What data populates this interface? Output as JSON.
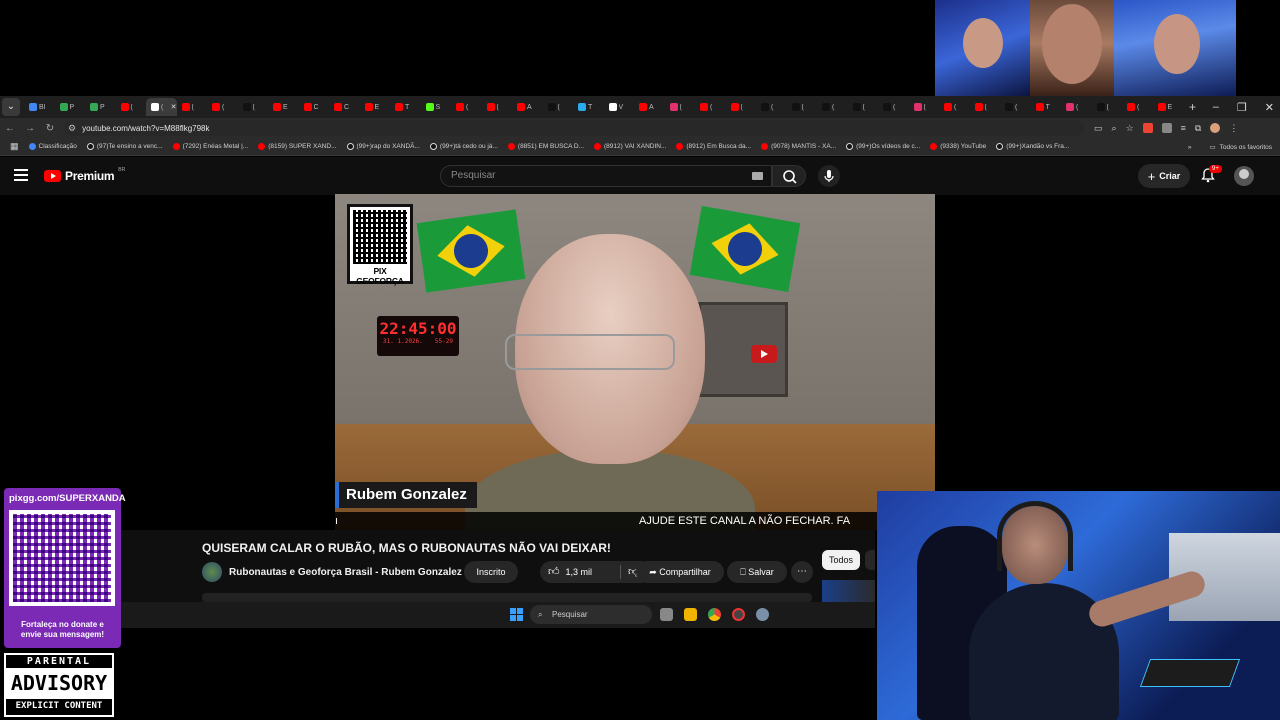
{
  "browser": {
    "tabs": [
      {
        "label": "Bl",
        "color": "#4285f4"
      },
      {
        "label": "P",
        "color": "#34a853"
      },
      {
        "label": "P",
        "color": "#34a853"
      },
      {
        "label": "(",
        "color": "#ff0000"
      },
      {
        "label": "(",
        "color": "#ffffff",
        "active": true
      },
      {
        "label": "(",
        "color": "#ff0000"
      },
      {
        "label": "(",
        "color": "#ff0000"
      },
      {
        "label": "(",
        "color": "#111111"
      },
      {
        "label": "E",
        "color": "#ff0000"
      },
      {
        "label": "C",
        "color": "#ff0000"
      },
      {
        "label": "C",
        "color": "#ff0000"
      },
      {
        "label": "E",
        "color": "#ff0000"
      },
      {
        "label": "T",
        "color": "#ff0000"
      },
      {
        "label": "S",
        "color": "#53fc18"
      },
      {
        "label": "(",
        "color": "#ff0000"
      },
      {
        "label": "(",
        "color": "#ff0000"
      },
      {
        "label": "A",
        "color": "#ff0000"
      },
      {
        "label": "(",
        "color": "#111111"
      },
      {
        "label": "T",
        "color": "#2aabee"
      },
      {
        "label": "V",
        "color": "#ffffff"
      },
      {
        "label": "A",
        "color": "#ff0000"
      },
      {
        "label": "(",
        "color": "#e1306c"
      },
      {
        "label": "(",
        "color": "#ff0000"
      },
      {
        "label": "(",
        "color": "#ff0000"
      },
      {
        "label": "(",
        "color": "#111111"
      },
      {
        "label": "(",
        "color": "#111111"
      },
      {
        "label": "(",
        "color": "#111111"
      },
      {
        "label": "(",
        "color": "#111111"
      },
      {
        "label": "(",
        "color": "#111111"
      },
      {
        "label": "(",
        "color": "#e1306c"
      },
      {
        "label": "(",
        "color": "#ff0000"
      },
      {
        "label": "(",
        "color": "#ff0000"
      },
      {
        "label": "(",
        "color": "#111111"
      },
      {
        "label": "T",
        "color": "#ff0000"
      },
      {
        "label": "(",
        "color": "#e1306c"
      },
      {
        "label": "(",
        "color": "#111111"
      },
      {
        "label": "(",
        "color": "#ff0000"
      },
      {
        "label": "E",
        "color": "#ff0000"
      }
    ],
    "new_tab": "+",
    "window_controls": {
      "minimize": "–",
      "maximize": "❐",
      "close": "✕"
    },
    "url": "youtube.com/watch?v=M88flkg798k",
    "bookmarks": [
      {
        "label": "Classificação",
        "color": "#4285f4"
      },
      {
        "label": "(97)Te ensino a venc...",
        "color": "#111111"
      },
      {
        "label": "(7292) Enéas Metal |...",
        "color": "#ff0000"
      },
      {
        "label": "(8159) SUPER XAND...",
        "color": "#ff0000"
      },
      {
        "label": "(99+)rap do XANDÃ...",
        "color": "#111111"
      },
      {
        "label": "(99+)tá cedo ou já...",
        "color": "#111111"
      },
      {
        "label": "(8851) EM BUSCA D...",
        "color": "#ff0000"
      },
      {
        "label": "(8912) VAI XANDIN...",
        "color": "#ff0000"
      },
      {
        "label": "(8912) Em Busca da...",
        "color": "#ff0000"
      },
      {
        "label": "(9078) MANTIS - XA...",
        "color": "#ff0000"
      },
      {
        "label": "(99+)Os vídeos de c...",
        "color": "#111111"
      },
      {
        "label": "(9338) YouTube",
        "color": "#ff0000"
      },
      {
        "label": "(99+)Xandão vs Fra...",
        "color": "#111111"
      }
    ],
    "all_favorites": "Todos os favoritos"
  },
  "youtube": {
    "logo_text": "Premium",
    "logo_country": "BR",
    "search_placeholder": "Pesquisar",
    "create_label": "Criar",
    "notification_badge": "9+",
    "video": {
      "qr_caption": "PIX GEOFORÇA",
      "clock_time": "22:45:00",
      "clock_date_left": "31. 1.2026.",
      "clock_date_right": "55-29",
      "lower_third_name": "Rubem Gonzalez",
      "ticker_text": "AJUDE ESTE CANAL A NÃO FECHAR. FA"
    },
    "title": "QUISERAM CALAR O RUBÃO, MAS O RUBONAUTAS NÃO VAI DEIXAR!",
    "channel_name": "Rubonautas e Geoforça Brasil - Rubem Gonzalez",
    "subscribed_label": "Inscrito",
    "like_count": "1,3 mil",
    "share_label": "Compartilhar",
    "save_label": "Salvar",
    "chip_all": "Todos"
  },
  "taskbar": {
    "search_placeholder": "Pesquisar"
  },
  "overlay": {
    "donate_url": "pixgg.com/SUPERXANDA",
    "donate_message_1": "Fortaleça no donate e",
    "donate_message_2": "envie sua mensagem!",
    "advisory_line1": "PARENTAL",
    "advisory_line2": "ADVISORY",
    "advisory_line3": "EXPLICIT CONTENT"
  }
}
